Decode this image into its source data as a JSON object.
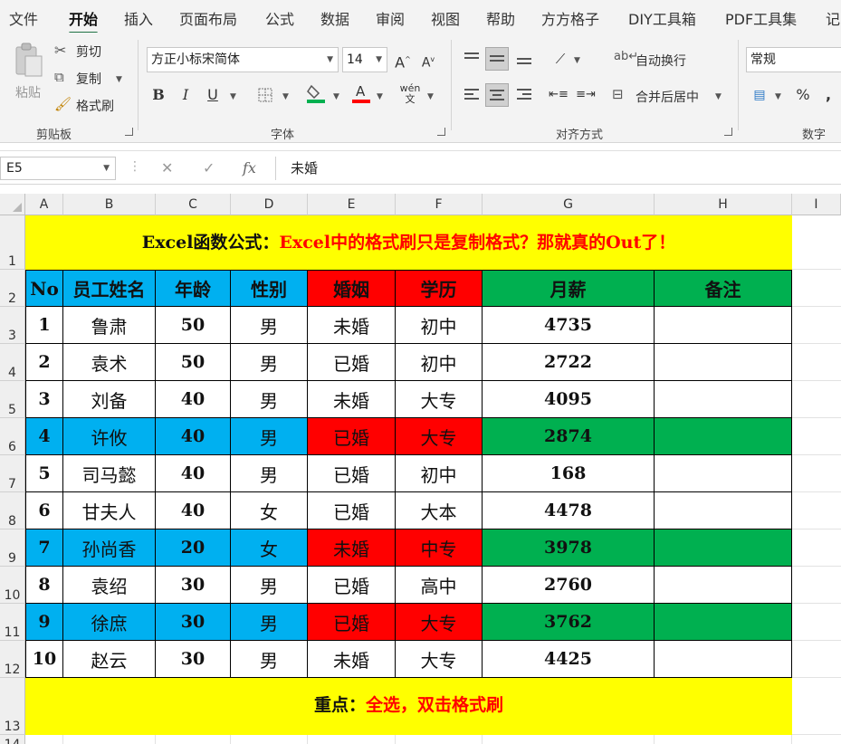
{
  "menu": {
    "tabs": [
      "文件",
      "开始",
      "插入",
      "页面布局",
      "公式",
      "数据",
      "审阅",
      "视图",
      "帮助",
      "方方格子",
      "DIY工具箱",
      "PDF工具集",
      "记"
    ],
    "active_index": 1
  },
  "ribbon": {
    "clipboard": {
      "paste": "粘贴",
      "cut": "剪切",
      "copy": "复制",
      "format_painter": "格式刷",
      "group_label": "剪贴板"
    },
    "font": {
      "font_name": "方正小标宋简体",
      "font_size": "14",
      "group_label": "字体"
    },
    "alignment": {
      "wrap_text": "自动换行",
      "merge_center": "合并后居中",
      "group_label": "对齐方式"
    },
    "number": {
      "format": "常规",
      "group_label": "数字"
    }
  },
  "formula_bar": {
    "cell_ref": "E5",
    "content": "未婚",
    "fx": "fx"
  },
  "columns": [
    "A",
    "B",
    "C",
    "D",
    "E",
    "F",
    "G",
    "H",
    "I"
  ],
  "rows": [
    "1",
    "2",
    "3",
    "4",
    "5",
    "6",
    "7",
    "8",
    "9",
    "10",
    "11",
    "12",
    "13",
    "14"
  ],
  "sheet": {
    "title_prefix": "Excel函数公式：",
    "title_red": "Excel中的格式刷只是复制格式？那就真的Out了！",
    "headers": [
      "No",
      "员工姓名",
      "年龄",
      "性别",
      "婚姻",
      "学历",
      "月薪",
      "备注"
    ],
    "rows": [
      [
        "1",
        "鲁肃",
        "50",
        "男",
        "未婚",
        "初中",
        "4735",
        ""
      ],
      [
        "2",
        "袁术",
        "50",
        "男",
        "已婚",
        "初中",
        "2722",
        ""
      ],
      [
        "3",
        "刘备",
        "40",
        "男",
        "未婚",
        "大专",
        "4095",
        ""
      ],
      [
        "4",
        "许攸",
        "40",
        "男",
        "已婚",
        "大专",
        "2874",
        ""
      ],
      [
        "5",
        "司马懿",
        "40",
        "男",
        "已婚",
        "初中",
        "168",
        ""
      ],
      [
        "6",
        "甘夫人",
        "40",
        "女",
        "已婚",
        "大本",
        "4478",
        ""
      ],
      [
        "7",
        "孙尚香",
        "20",
        "女",
        "未婚",
        "中专",
        "3978",
        ""
      ],
      [
        "8",
        "袁绍",
        "30",
        "男",
        "已婚",
        "高中",
        "2760",
        ""
      ],
      [
        "9",
        "徐庶",
        "30",
        "男",
        "已婚",
        "大专",
        "3762",
        ""
      ],
      [
        "10",
        "赵云",
        "30",
        "男",
        "未婚",
        "大专",
        "4425",
        ""
      ]
    ],
    "footer_prefix": "重点：",
    "footer_red": "全选，双击格式刷"
  },
  "colors": {
    "blue": "#00b0f0",
    "red": "#ff0000",
    "green": "#00b050",
    "yellow": "#ffff00",
    "excel_green": "#217346"
  }
}
